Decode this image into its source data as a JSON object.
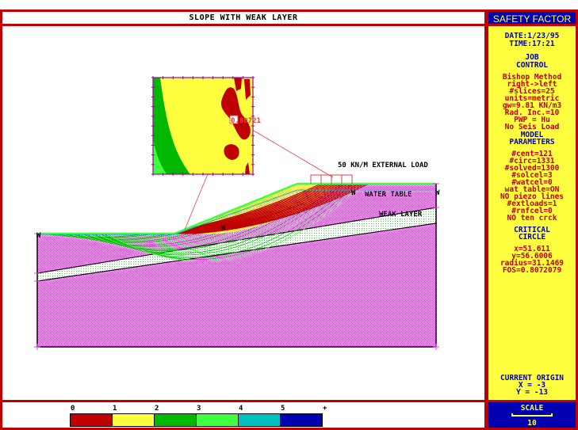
{
  "title": "SLOPE WITH WEAK LAYER",
  "side_title": "SAFETY FACTOR",
  "side_panel": {
    "date": "DATE:1/23/95",
    "time": "TIME:17:21",
    "job_control_heading": [
      "JOB",
      "CONTROL"
    ],
    "job_control": [
      "Bishop Method",
      "right->left",
      "#slices=25",
      "units=metric",
      "gw=9.81 KN/m3",
      "Rad. Inc.=10",
      "PWP = Hu",
      "No Seis Load"
    ],
    "model_heading": [
      "MODEL",
      "PARAMETERS"
    ],
    "model": [
      "#cent=121",
      "#circ=1331",
      "#solved=1300",
      "#solcel=3",
      "#watcel=0",
      "wat table=ON",
      "NO piezo lines",
      "#extloads=1",
      "#rnfcel=0",
      "NO ten crck"
    ],
    "critical_heading": [
      "CRITICAL",
      "CIRCLE"
    ],
    "critical": [
      "x=51.611",
      "y=56.6006",
      "radius=31.1469",
      "FOS=0.8072079"
    ],
    "origin_heading": "CURRENT ORIGIN",
    "origin_x": "X  = -3",
    "origin_y": "Y  = -13"
  },
  "scale": {
    "label": "SCALE",
    "value": "10"
  },
  "plot": {
    "inset_fos_label": "0.80721",
    "load_label": "50 KN/M EXTERNAL LOAD",
    "water_table_label": "WATER TABLE",
    "weak_layer_label": "WEAK LAYER",
    "water_marker": "W"
  },
  "legend": {
    "labels": [
      "0",
      "1",
      "2",
      "3",
      "4",
      "5",
      "+"
    ],
    "colors": [
      "#c00000",
      "#ffff40",
      "#00b800",
      "#40ff40",
      "#00c0c0",
      "#0000b0"
    ]
  },
  "colors": {
    "frame": "#c00000",
    "soil": "#e040e0",
    "surface": "#40ff40",
    "water": "#00c0c0"
  }
}
